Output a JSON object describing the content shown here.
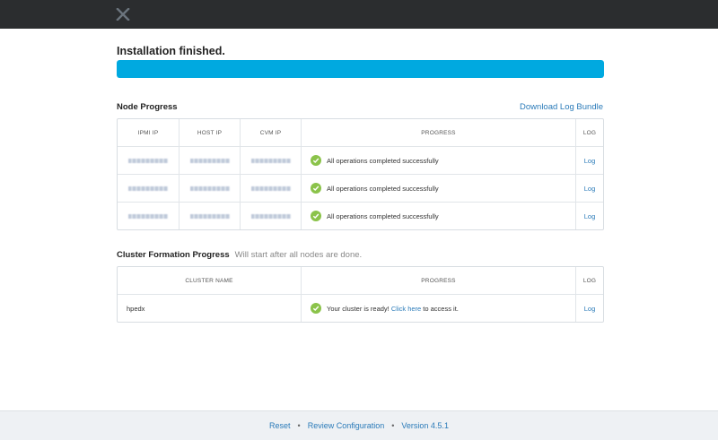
{
  "colors": {
    "topbar": "#2b2d2f",
    "progress": "#00a9e0",
    "success": "#8bc34a",
    "link": "#2b7bb9"
  },
  "status": {
    "title": "Installation finished.",
    "progress": 1.0
  },
  "node_progress": {
    "title": "Node Progress",
    "download_link": "Download Log Bundle",
    "columns": [
      "IPMI IP",
      "HOST IP",
      "CVM IP",
      "PROGRESS",
      "LOG"
    ],
    "rows": [
      {
        "progress": "All operations completed successfully",
        "log": "Log"
      },
      {
        "progress": "All operations completed successfully",
        "log": "Log"
      },
      {
        "progress": "All operations completed successfully",
        "log": "Log"
      }
    ]
  },
  "cluster_progress": {
    "title": "Cluster Formation Progress",
    "note": "Will start after all nodes are done.",
    "columns": [
      "CLUSTER NAME",
      "PROGRESS",
      "LOG"
    ],
    "rows": [
      {
        "name": "hpedx",
        "progress_prefix": "Your cluster is ready!",
        "link": "Click here",
        "progress_suffix": "to access it.",
        "log": "Log"
      }
    ]
  },
  "footer": {
    "reset": "Reset",
    "review": "Review Configuration",
    "version": "Version 4.5.1"
  },
  "icons": {
    "logo": "x-logo-icon",
    "check": "check-circle-icon"
  }
}
